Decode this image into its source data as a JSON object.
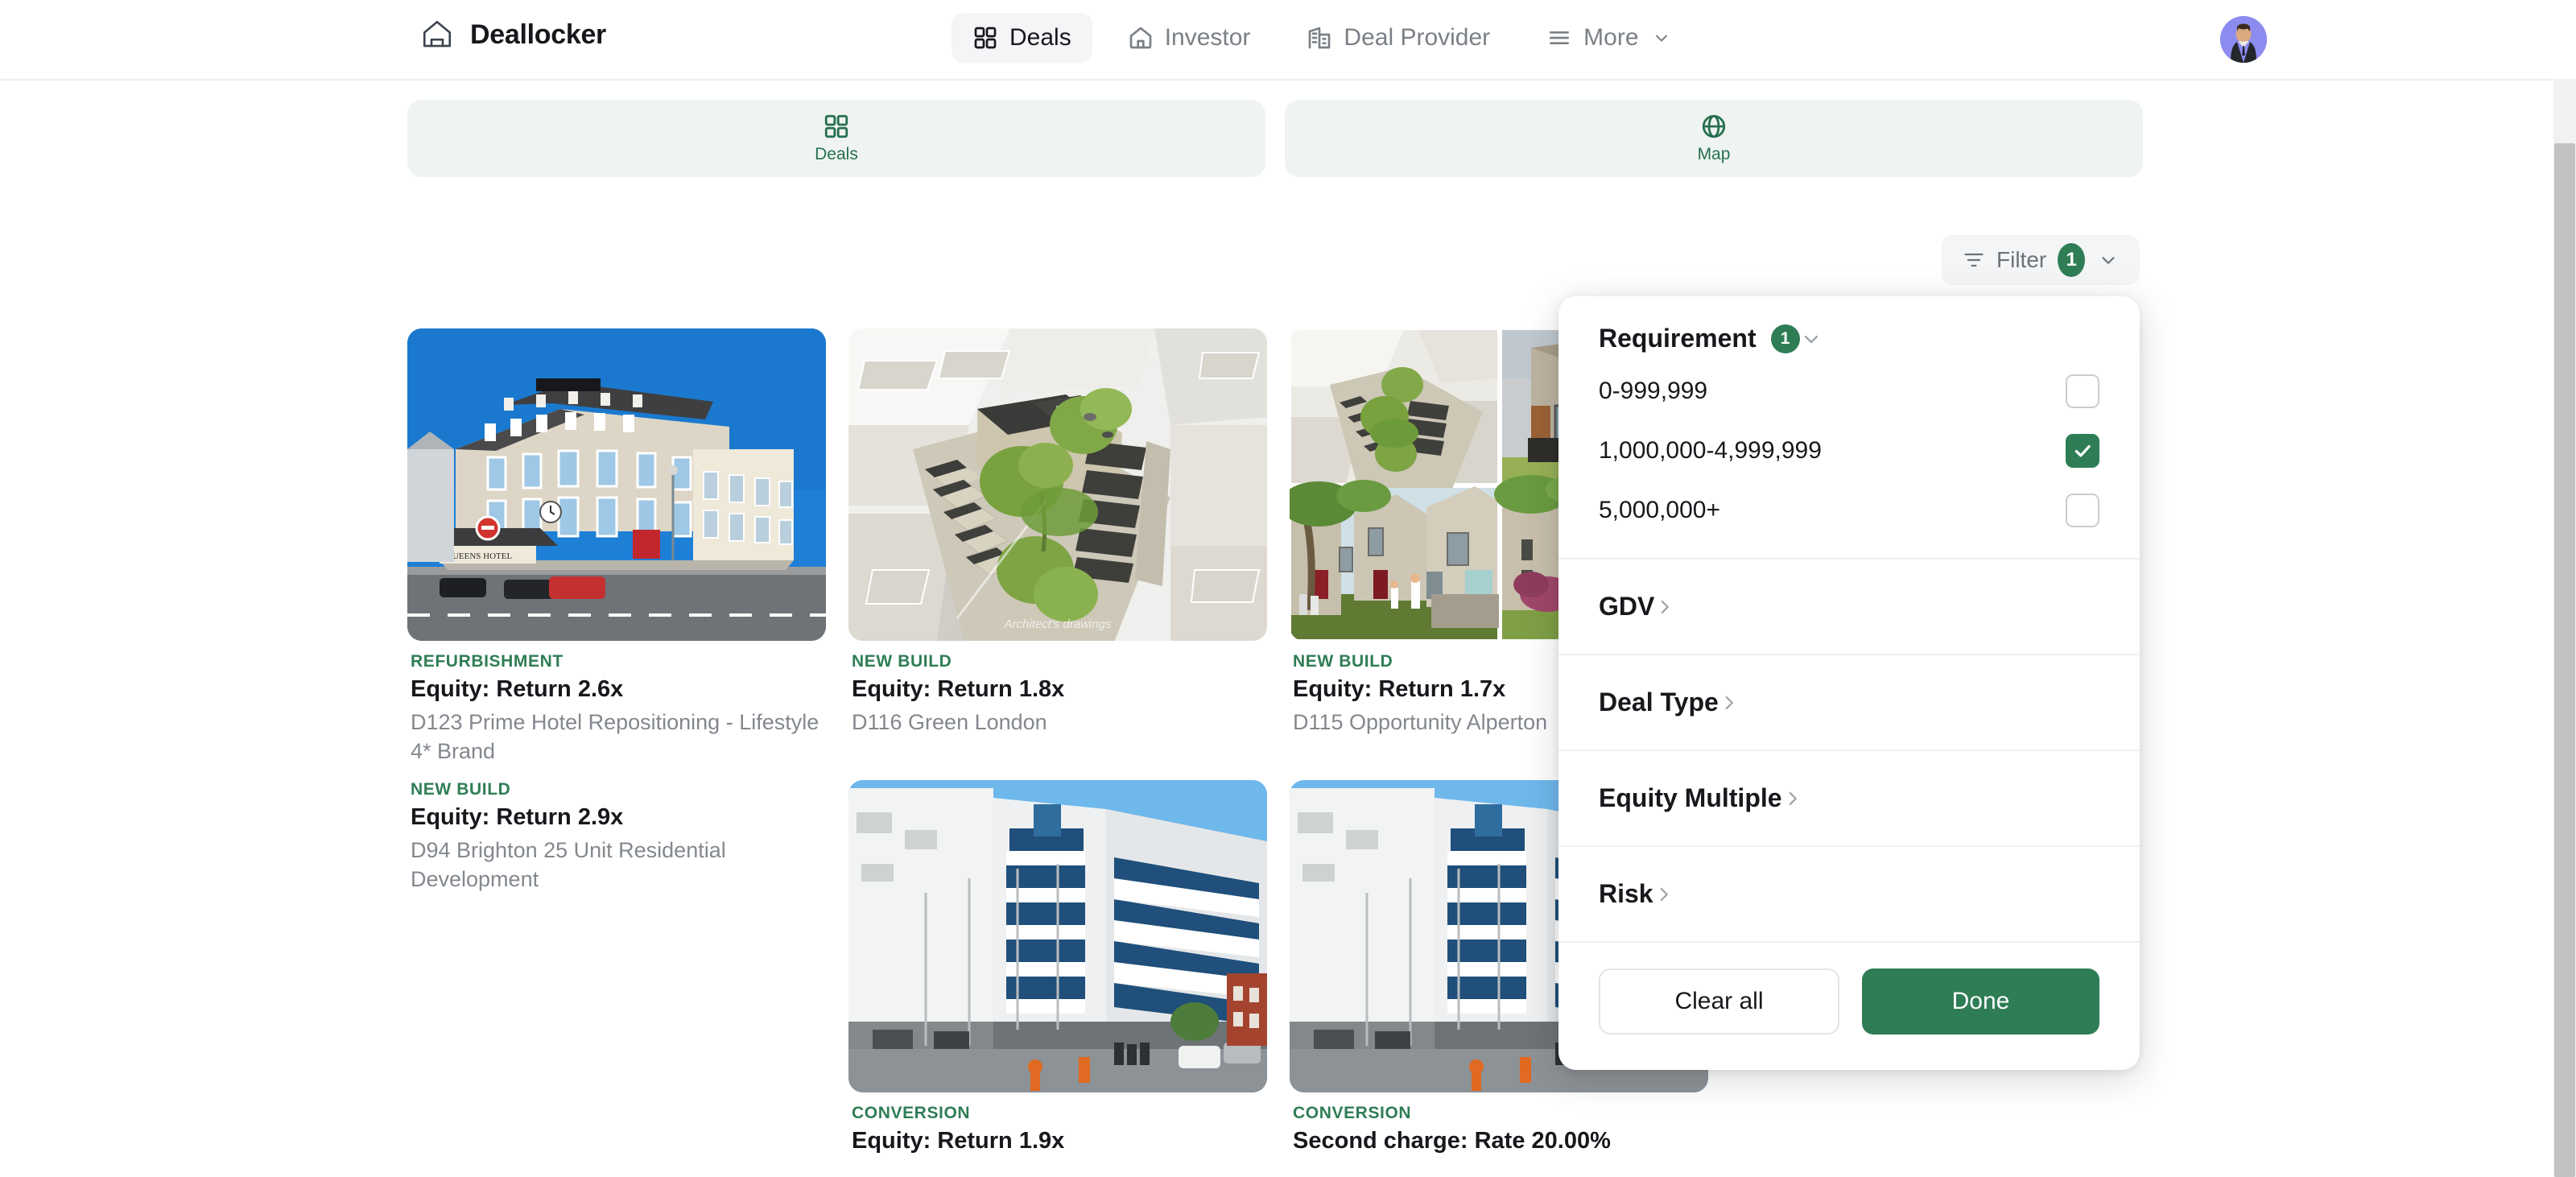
{
  "header": {
    "logo_icon": "home-outline-icon",
    "brand": "Deallocker",
    "nav": [
      {
        "label": "Deals",
        "icon": "grid-icon",
        "active": true
      },
      {
        "label": "Investor",
        "icon": "home-icon",
        "active": false
      },
      {
        "label": "Deal Provider",
        "icon": "building-icon",
        "active": false
      },
      {
        "label": "More",
        "icon": "menu-icon",
        "active": false,
        "caret": "chevron-down-icon"
      }
    ],
    "avatar": "user-avatar"
  },
  "tabs": [
    {
      "label": "Deals",
      "icon": "grid-icon"
    },
    {
      "label": "Map",
      "icon": "globe-icon"
    }
  ],
  "toolbar": {
    "filter_label": "Filter",
    "filter_count": "1",
    "filter_icon": "filter-icon",
    "filter_caret": "chevron-down-icon"
  },
  "deals": [
    {
      "tag": "REFURBISHMENT",
      "title": "Equity: Return 2.6x",
      "subtitle": "D123 Prime Hotel Repositioning - Lifestyle 4* Brand",
      "image": "victorian-hotel-photo"
    },
    {
      "tag": "NEW BUILD",
      "title": "Equity: Return 1.8x",
      "subtitle": "D116 Green London",
      "image": "aerial-architect-render"
    },
    {
      "tag": "NEW BUILD",
      "title": "Equity: Return 1.7x",
      "subtitle": "D115 Opportunity Alperton",
      "image": "render-collage"
    },
    {
      "tag": "NEW BUILD",
      "title": "Equity: Return 2.9x",
      "subtitle": "D94 Brighton 25 Unit Residential Development",
      "image": "none"
    },
    {
      "tag": "CONVERSION",
      "title": "Equity: Return 1.9x",
      "subtitle": "",
      "image": "office-building-photo"
    },
    {
      "tag": "CONVERSION",
      "title": "Second charge: Rate 20.00%",
      "subtitle": "",
      "image": "office-building-photo"
    }
  ],
  "filter_panel": {
    "section_title": "Requirement",
    "section_badge": "1",
    "collapse_icon": "chevron-down-icon",
    "options": [
      {
        "label": "0-999,999",
        "checked": false
      },
      {
        "label": "1,000,000-4,999,999",
        "checked": true
      },
      {
        "label": "5,000,000+",
        "checked": false
      }
    ],
    "rows": [
      {
        "label": "GDV",
        "icon": "chevron-right-icon"
      },
      {
        "label": "Deal Type",
        "icon": "chevron-right-icon"
      },
      {
        "label": "Equity Multiple",
        "icon": "chevron-right-icon"
      },
      {
        "label": "Risk",
        "icon": "chevron-right-icon"
      }
    ],
    "clear_label": "Clear all",
    "done_label": "Done"
  },
  "colors": {
    "brand_green": "#2f7d55",
    "tab_bg": "#eff3f2",
    "text_dark": "#16181c",
    "text_muted": "#83888e"
  }
}
